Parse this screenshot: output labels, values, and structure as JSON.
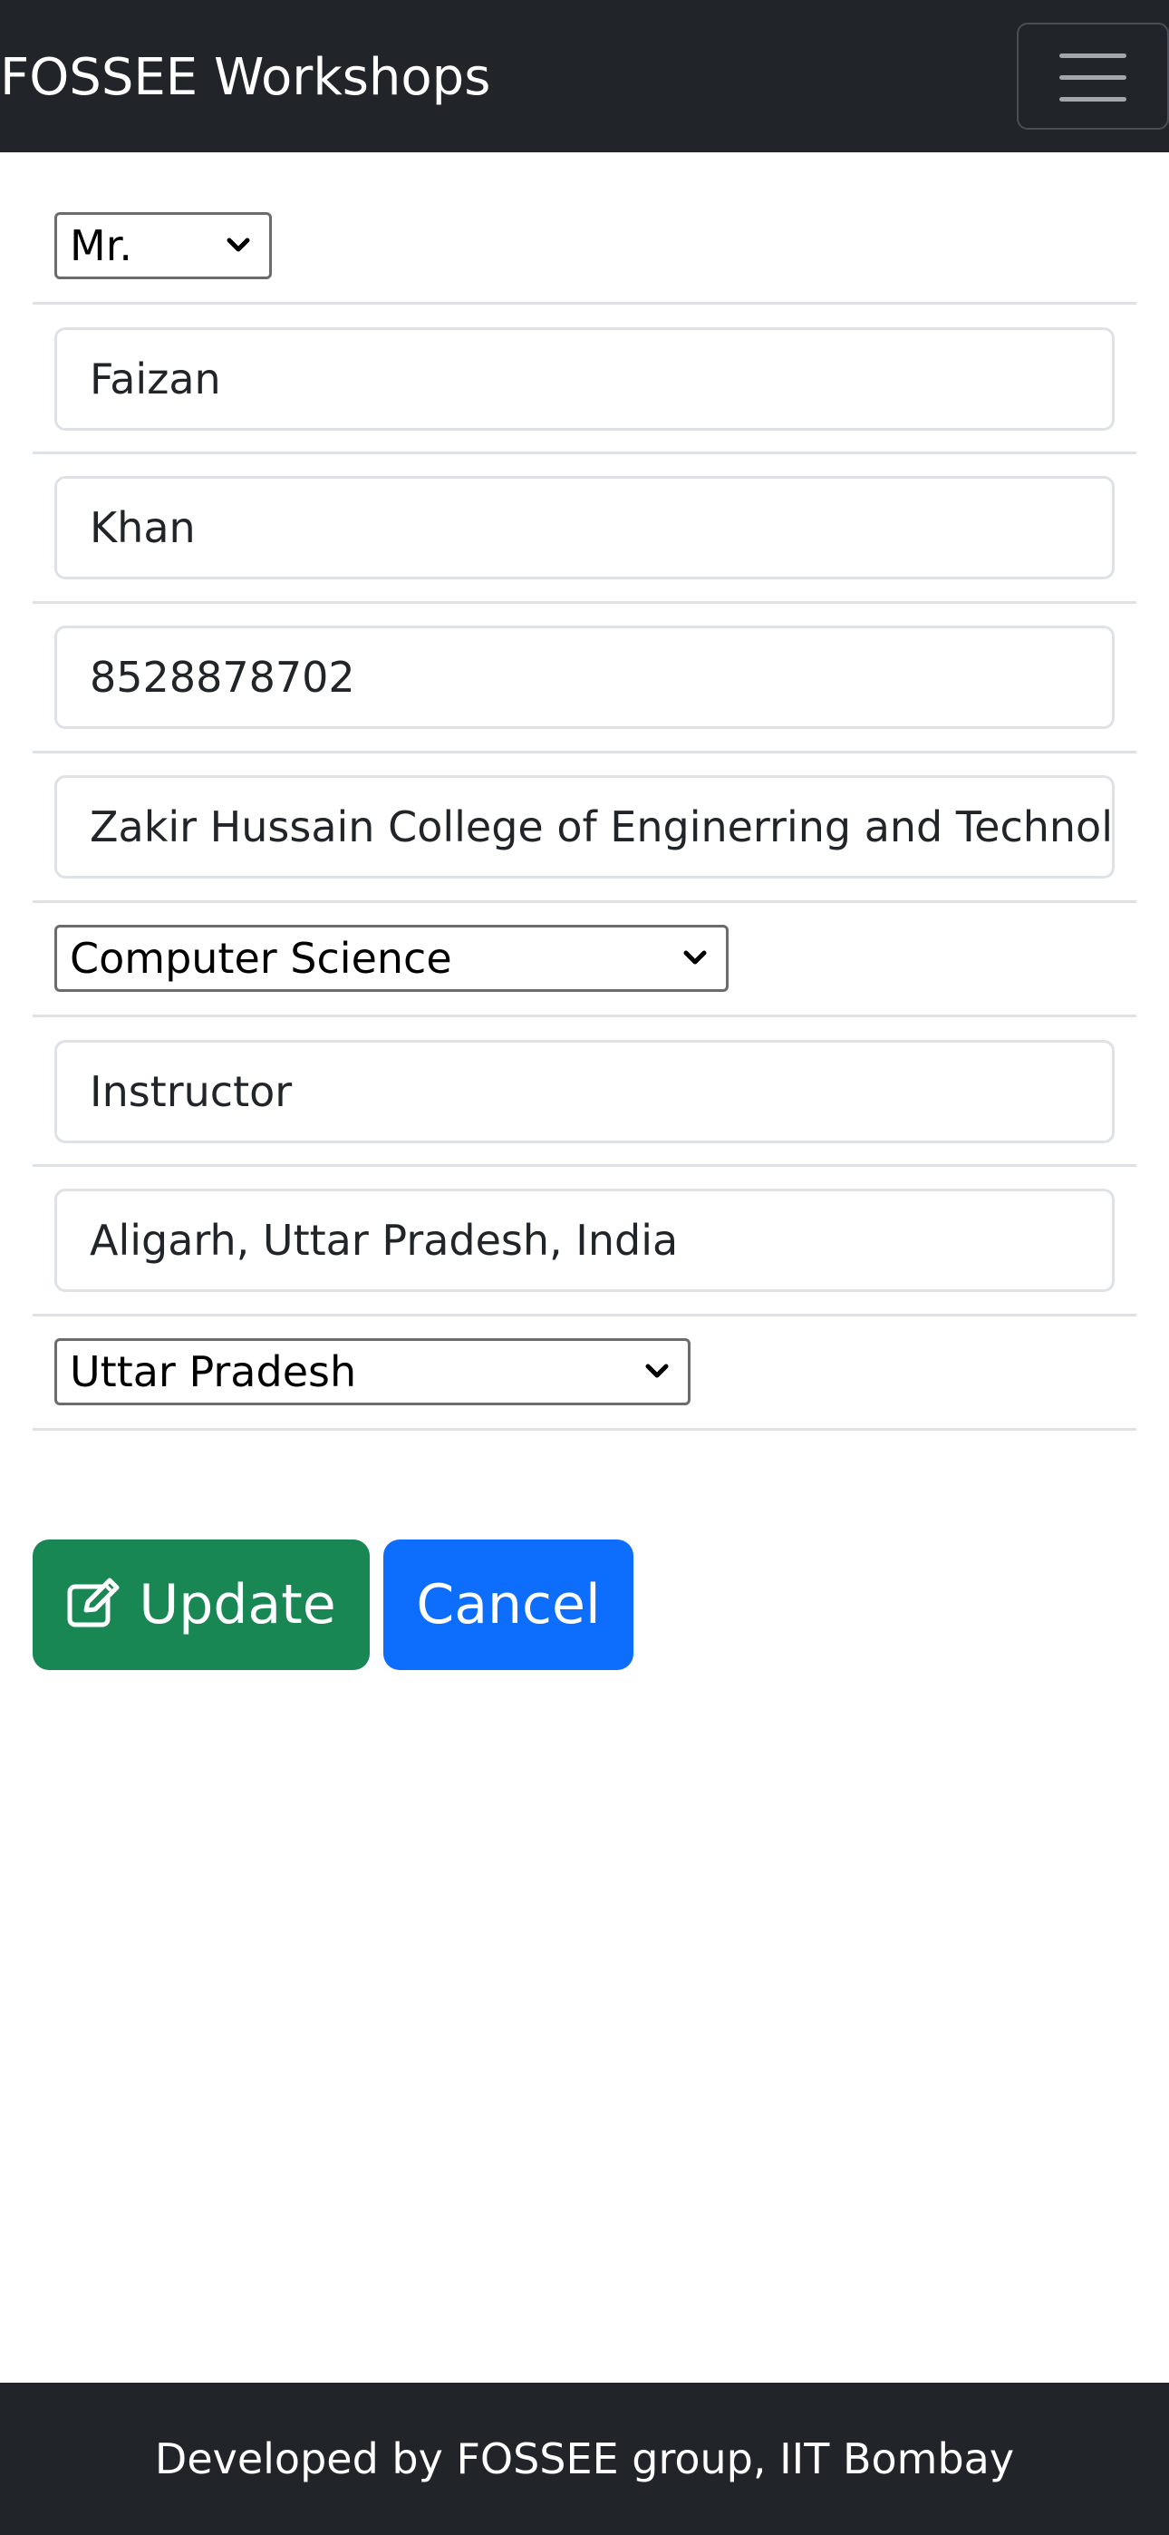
{
  "navbar": {
    "brand": "FOSSEE Workshops",
    "toggler_icon": "hamburger-menu-icon"
  },
  "form": {
    "title_select": {
      "value": "Mr."
    },
    "first_name": {
      "value": "Faizan"
    },
    "last_name": {
      "value": "Khan"
    },
    "phone": {
      "value": "8528878702"
    },
    "institute": {
      "value": "Zakir Hussain College of Enginerring and Technolog"
    },
    "department_select": {
      "value": "Computer Science"
    },
    "position": {
      "value": "Instructor"
    },
    "location": {
      "value": "Aligarh, Uttar Pradesh, India"
    },
    "state_select": {
      "value": "Uttar Pradesh"
    }
  },
  "actions": {
    "update_label": "Update",
    "update_icon": "edit-icon",
    "cancel_label": "Cancel"
  },
  "footer": {
    "text": "Developed by FOSSEE group, IIT Bombay"
  },
  "colors": {
    "navbar_bg": "#212529",
    "update_green": "#198754",
    "cancel_blue": "#0d6efd"
  }
}
